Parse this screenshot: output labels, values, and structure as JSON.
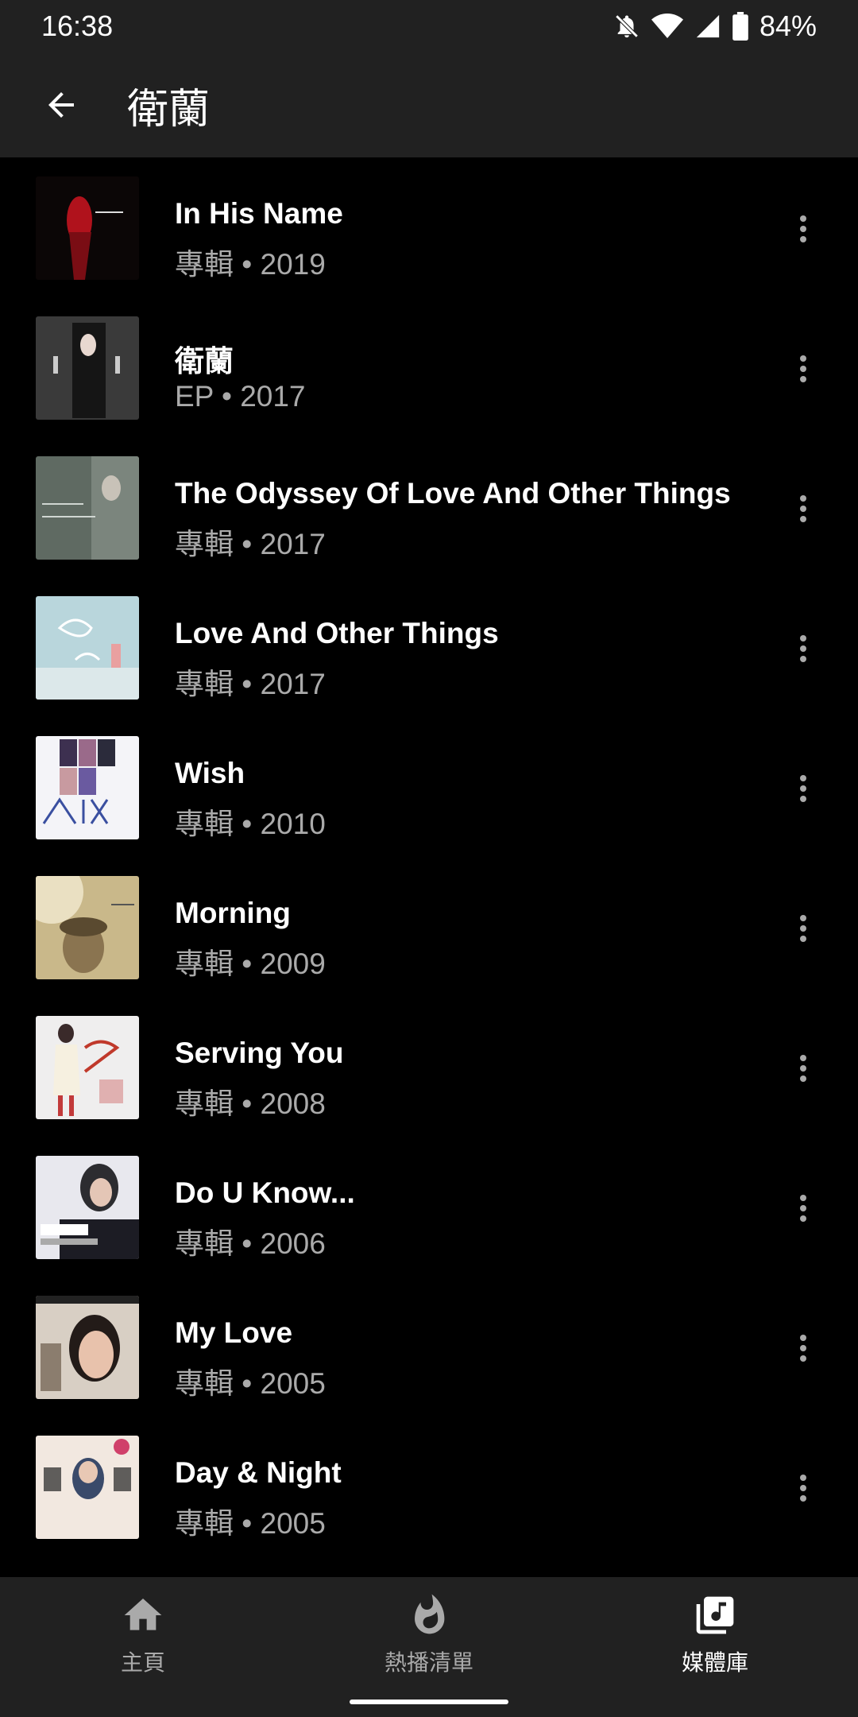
{
  "status_bar": {
    "time": "16:38",
    "battery": "84%"
  },
  "header": {
    "title": "衛蘭"
  },
  "albums": [
    {
      "name": "In His Name",
      "meta": "專輯 • 2019"
    },
    {
      "name": "衛蘭",
      "meta": "EP • 2017"
    },
    {
      "name": "The Odyssey Of Love And Other Things",
      "meta": "專輯 • 2017"
    },
    {
      "name": "Love And Other Things",
      "meta": "專輯 • 2017"
    },
    {
      "name": "Wish",
      "meta": "專輯 • 2010"
    },
    {
      "name": "Morning",
      "meta": "專輯 • 2009"
    },
    {
      "name": "Serving You",
      "meta": "專輯 • 2008"
    },
    {
      "name": "Do U Know...",
      "meta": "專輯 • 2006"
    },
    {
      "name": "My Love",
      "meta": "專輯 • 2005"
    },
    {
      "name": "Day & Night",
      "meta": "專輯 • 2005"
    }
  ],
  "nav": {
    "home": "主頁",
    "hotlist": "熱播清單",
    "library": "媒體庫"
  },
  "colors": {
    "bar": "#212121",
    "background": "#000000",
    "subtext": "#aaaaaa"
  }
}
